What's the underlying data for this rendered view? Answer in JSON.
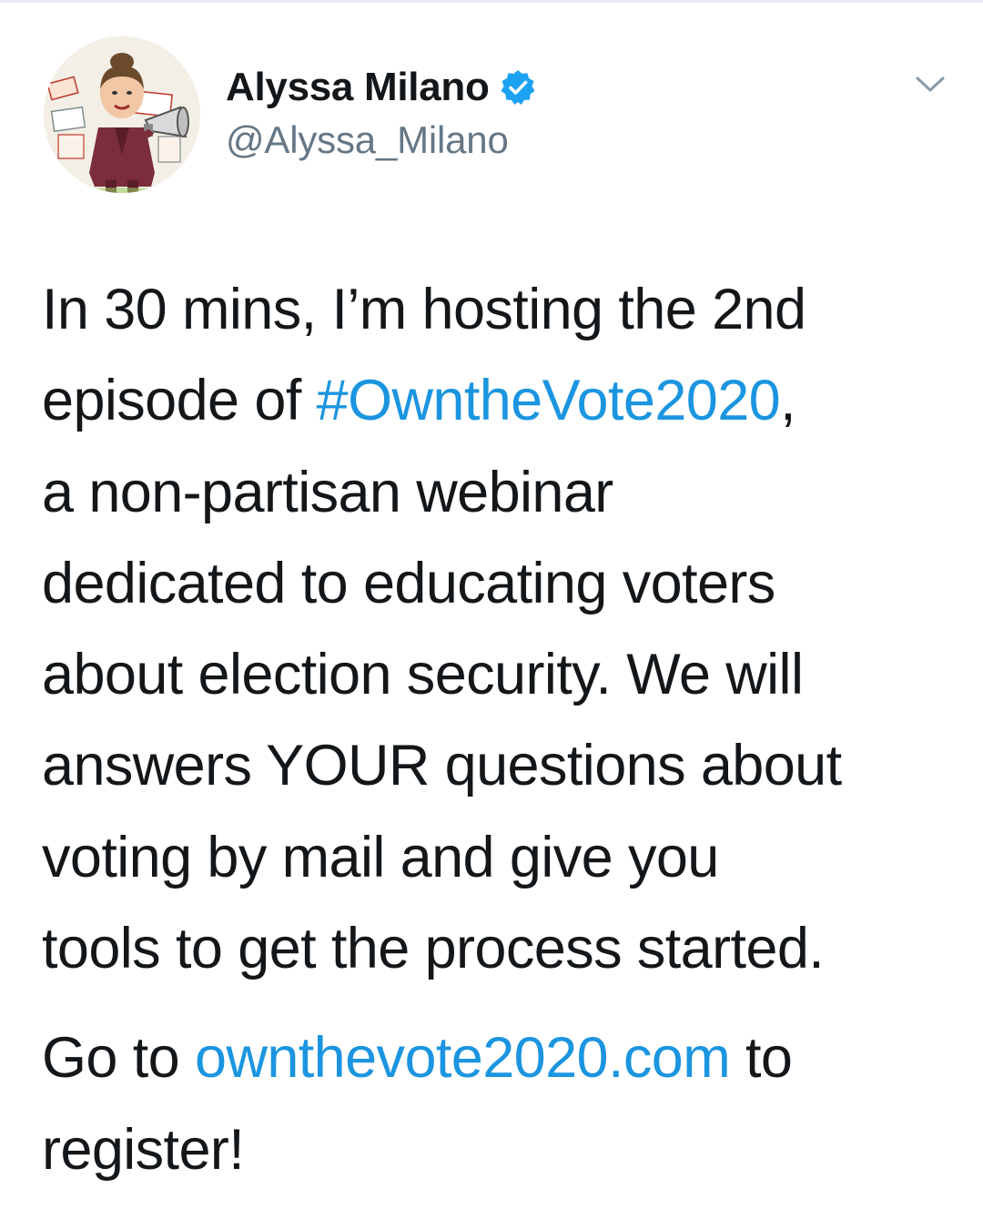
{
  "tweet": {
    "author": {
      "display_name": "Alyssa Milano",
      "handle": "@Alyssa_Milano",
      "verified": true,
      "avatar_icon": "caricature-avatar-icon"
    },
    "menu_icon": "chevron-down-icon",
    "lines_p1": [
      {
        "pre": "In 30 mins, I’m hosting the 2nd"
      },
      {
        "pre": "episode of ",
        "link": "#OwntheVote2020",
        "post": ","
      },
      {
        "pre": "a non-partisan webinar"
      },
      {
        "pre": "dedicated to educating voters"
      },
      {
        "pre": "about election security. We will"
      },
      {
        "pre": "answers YOUR questions about"
      },
      {
        "pre": "voting by mail and give you"
      },
      {
        "pre": "tools to get the process started."
      }
    ],
    "lines_p2": [
      {
        "pre": "Go to ",
        "link": "ownthevote2020.com",
        "post": " to"
      },
      {
        "pre": "register!"
      }
    ]
  },
  "colors": {
    "text": "#14171a",
    "secondary": "#657786",
    "link": "#1b95e0",
    "verified_badge": "#1da1f2"
  }
}
